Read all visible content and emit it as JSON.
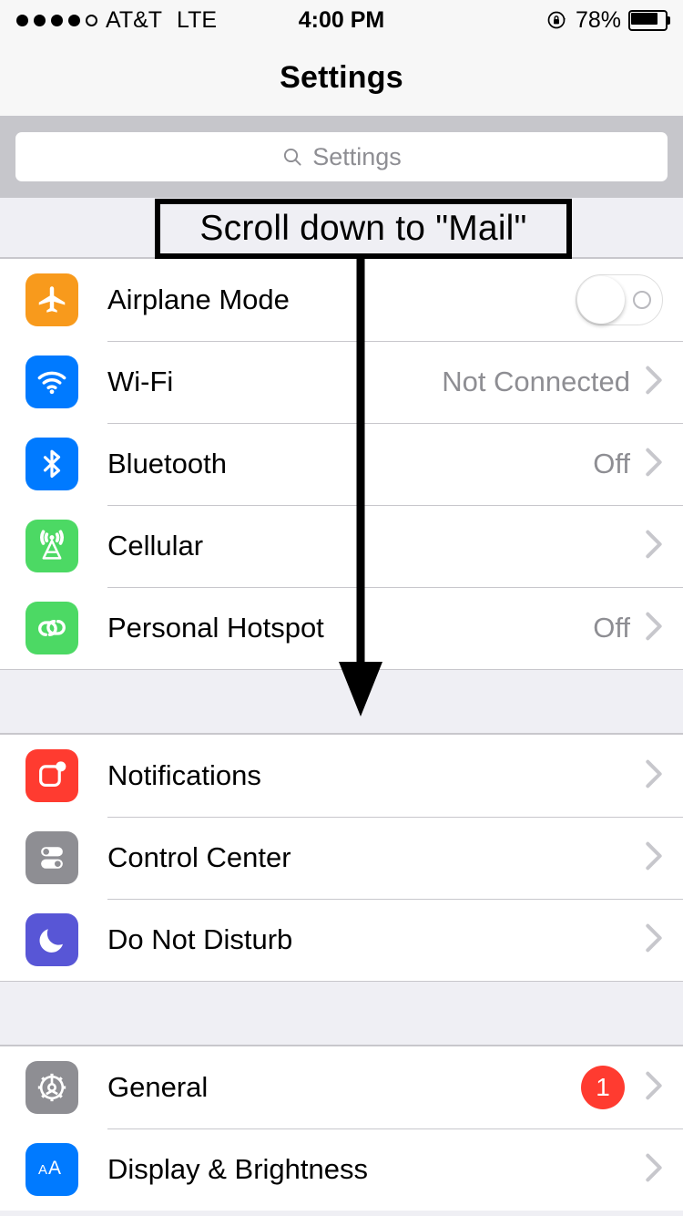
{
  "status_bar": {
    "signal_dots_total": 5,
    "signal_dots_filled": 4,
    "carrier": "AT&T",
    "network_type": "LTE",
    "time": "4:00 PM",
    "rotation_lock_icon": "rotation-lock-icon",
    "battery_percent_label": "78%",
    "battery_level": 78
  },
  "navbar": {
    "title": "Settings"
  },
  "search": {
    "icon": "search-icon",
    "placeholder": "Settings",
    "value": ""
  },
  "annotation": {
    "text": "Scroll down to \"Mail\"",
    "arrow": "down-arrow",
    "border_color": "#000000",
    "fill_color": "#EFEFF4"
  },
  "colors": {
    "airplane_orange": "#F89A1C",
    "blue": "#007AFF",
    "green": "#4CD964",
    "red": "#FF3B30",
    "gray": "#8E8E93",
    "purple": "#5856D6",
    "chevron_gray": "#C7C7CC",
    "value_gray": "#8E8E93",
    "separator": "#C8C7CC",
    "group_bg": "#EFEFF4",
    "search_band": "#C6C6CB"
  },
  "groups": [
    {
      "name": "connectivity",
      "rows": [
        {
          "label": "Airplane Mode",
          "icon": "airplane-icon",
          "icon_color": "#F89A1C",
          "accessory": "toggle",
          "toggle_on": false,
          "value": ""
        },
        {
          "label": "Wi-Fi",
          "icon": "wifi-icon",
          "icon_color": "#007AFF",
          "accessory": "chevron",
          "value": "Not Connected"
        },
        {
          "label": "Bluetooth",
          "icon": "bluetooth-icon",
          "icon_color": "#007AFF",
          "accessory": "chevron",
          "value": "Off"
        },
        {
          "label": "Cellular",
          "icon": "cellular-icon",
          "icon_color": "#4CD964",
          "accessory": "chevron",
          "value": ""
        },
        {
          "label": "Personal Hotspot",
          "icon": "hotspot-icon",
          "icon_color": "#4CD964",
          "accessory": "chevron",
          "value": "Off"
        }
      ]
    },
    {
      "name": "alerts",
      "rows": [
        {
          "label": "Notifications",
          "icon": "notifications-icon",
          "icon_color": "#FF3B30",
          "accessory": "chevron",
          "value": ""
        },
        {
          "label": "Control Center",
          "icon": "control-center-icon",
          "icon_color": "#8E8E93",
          "accessory": "chevron",
          "value": ""
        },
        {
          "label": "Do Not Disturb",
          "icon": "moon-icon",
          "icon_color": "#5856D6",
          "accessory": "chevron",
          "value": ""
        }
      ]
    },
    {
      "name": "system",
      "rows": [
        {
          "label": "General",
          "icon": "gear-icon",
          "icon_color": "#8E8E93",
          "accessory": "chevron",
          "value": "",
          "badge": "1"
        },
        {
          "label": "Display & Brightness",
          "icon": "text-size-icon",
          "icon_color": "#007AFF",
          "accessory": "chevron",
          "value": ""
        }
      ]
    }
  ]
}
